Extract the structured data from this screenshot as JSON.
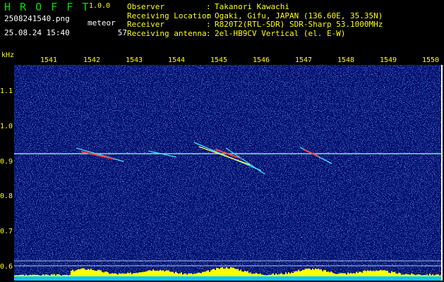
{
  "header": {
    "app_title": "H R O F F T",
    "app_version": "1.0.0",
    "file_name": "2508241540.png",
    "date_time": "25.08.24 15:40",
    "meteor_label": "meteor",
    "meteor_count": "57"
  },
  "info": {
    "observer": {
      "key": "Observer",
      "sep": ":",
      "value": "Takanori Kawachi"
    },
    "location": {
      "key": "Receiving Location",
      "sep": ":",
      "value": "Ogaki, Gifu, JAPAN (136.60E, 35.35N)"
    },
    "receiver": {
      "key": "Receiver",
      "sep": ":",
      "value": "R820T2(RTL-SDR) SDR-Sharp 53.1000MHz"
    },
    "antenna": {
      "key": "Receiving antenna",
      "sep": ":",
      "value": "2el-HB9CV Vertical (el. E-W)"
    }
  },
  "axes": {
    "y_unit": "kHz",
    "y_ticks": [
      "1.1",
      "1.0",
      "0.9",
      "0.8",
      "0.7",
      "0.6"
    ],
    "x_ticks": [
      "1541",
      "1542",
      "1543",
      "1544",
      "1545",
      "1546",
      "1547",
      "1548",
      "1549",
      "1550"
    ]
  },
  "colors": {
    "background": "#000e6e",
    "title_green": "#00e000",
    "label_yellow": "#ffff00",
    "text_white": "#ffffff",
    "carrier_cyan": "#9ff8ff",
    "meteor_trail": "#ff4040",
    "level_bar": "#ffff00",
    "level_base": "#00c8ff"
  }
}
